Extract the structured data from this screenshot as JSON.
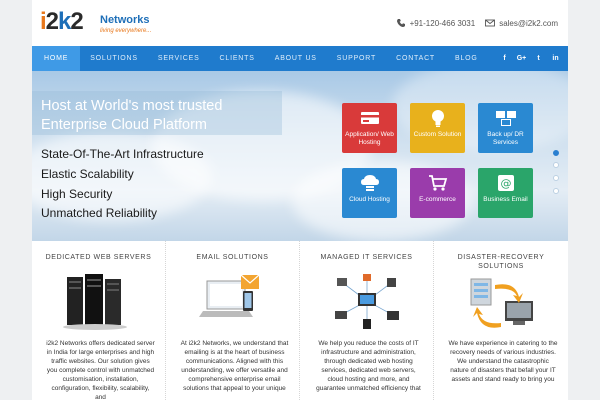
{
  "header": {
    "logo_mark": "i2k2",
    "logo_name": "Networks",
    "logo_tagline": "living everywhere...",
    "phone": "+91-120-466 3031",
    "email": "sales@i2k2.com"
  },
  "nav": {
    "items": [
      "HOME",
      "SOLUTIONS",
      "SERVICES",
      "CLIENTS",
      "ABOUT US",
      "SUPPORT",
      "CONTACT",
      "BLOG"
    ],
    "active_index": 0,
    "social": [
      "f",
      "G+",
      "t",
      "in"
    ]
  },
  "hero": {
    "title_line1": "Host at World's most trusted",
    "title_line2": "Enterprise Cloud Platform",
    "features": [
      "State-Of-The-Art Infrastructure",
      "Elastic Scalability",
      "High Security",
      "Unmatched Reliability"
    ],
    "tiles": [
      {
        "label": "Application/ Web Hosting",
        "color": "#d93a3a",
        "icon": "card-icon"
      },
      {
        "label": "Custom Solution",
        "color": "#e8b11c",
        "icon": "lightbulb-icon"
      },
      {
        "label": "Back up/ DR Services",
        "color": "#2a89d2",
        "icon": "computers-icon"
      },
      {
        "label": "Cloud Hosting",
        "color": "#2a89d2",
        "icon": "cloud-server-icon"
      },
      {
        "label": "E-commerce",
        "color": "#9a3cab",
        "icon": "cart-icon"
      },
      {
        "label": "Business Email",
        "color": "#2aa56a",
        "icon": "email-at-icon"
      }
    ],
    "slider_dots": 5,
    "active_dot": 0
  },
  "services": [
    {
      "title": "DEDICATED WEB SERVERS",
      "text": "i2k2 Networks offers dedicated server in India for large enterprises and high traffic websites. Our solution gives you complete control with unmatched customisation, installation, configuration, flexibility, scalability, and"
    },
    {
      "title": "EMAIL SOLUTIONS",
      "text": "At i2k2 Networks, we understand that emailing is at the heart of business communications. Aligned with this understanding, we offer versatile and comprehensive enterprise email solutions that appeal to your unique"
    },
    {
      "title": "MANAGED IT SERVICES",
      "text": "We help you reduce the costs of IT infrastructure and administration, through dedicated web hosting services, dedicated web servers, cloud hosting and more, and guarantee unmatched efficiency that"
    },
    {
      "title": "DISASTER-RECOVERY SOLUTIONS",
      "text": "We have experience in catering to the recovery needs of various industries. We understand the catastrophic nature of disasters that befall your IT assets and stand ready to bring you"
    }
  ],
  "colors": {
    "nav_bg": "#1f7bcd",
    "nav_active": "#3f9ae6",
    "brand_orange": "#e8781c",
    "brand_blue": "#1e6fb8"
  }
}
